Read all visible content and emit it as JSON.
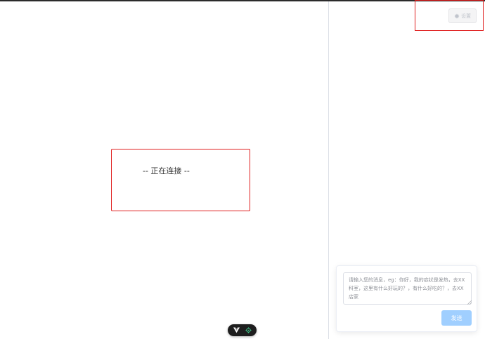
{
  "main": {
    "connection_status": "-- 正在连接 --"
  },
  "settings": {
    "label": "设置",
    "icon": "gear-icon"
  },
  "chat": {
    "input_value": "",
    "input_placeholder": "请输入您的消息，eg：你好，我的症状是发热，去XX科室，这里有什么好玩的？，有什么好吃的？，去XX店家",
    "send_label": "发送"
  },
  "devtools": {
    "icons": [
      "vue-logo-icon",
      "target-icon"
    ]
  },
  "colors": {
    "highlight_border": "#e02020",
    "send_button": "#a0cfff",
    "devtools_accent": "#42d392"
  }
}
